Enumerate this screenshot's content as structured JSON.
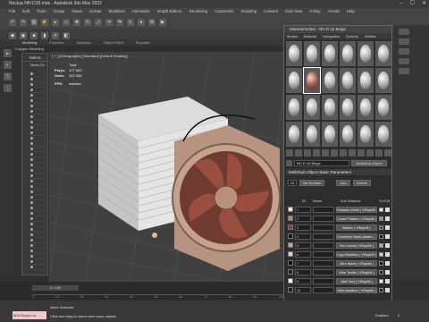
{
  "app": {
    "title": "Noctua NH-D15.max - Autodesk 3ds Max 2022",
    "win_controls": [
      "–",
      "☐",
      "✕"
    ]
  },
  "menu": [
    "File",
    "Edit",
    "Tools",
    "Group",
    "Views",
    "Create",
    "Modifiers",
    "Animation",
    "Graph Editors",
    "Rendering",
    "Customize",
    "Scripting",
    "Content",
    "Civil View",
    "V-Ray",
    "Arnold",
    "Help"
  ],
  "ribbon": {
    "tabs": [
      "Modeling",
      "Freeform",
      "Selection",
      "Object Paint",
      "Populate"
    ],
    "active": "Modeling",
    "sub": "Polygon Modeling"
  },
  "viewport": {
    "label": "[ + ] [Orthographic] [Standard] [Default Shading]",
    "stats": {
      "header": "Total",
      "polys_label": "Polys:",
      "polys": "477 663",
      "verts_label": "Verts:",
      "verts": "323 306",
      "fps_label": "FPS:",
      "fps": "Inactive"
    }
  },
  "scene_panel": {
    "title": "Select",
    "name_col": "Name (So"
  },
  "material_editor": {
    "title": "Material Editor - NH D 15 Beige",
    "menu": [
      "Modes",
      "Material",
      "Navigation",
      "Options",
      "Utilities"
    ],
    "name": "NH D 15 Beige",
    "type": "Multi/Sub-Object",
    "rollout": "Multi/Sub-Object Basic Parameters",
    "count": "25",
    "set_number": "Set Number",
    "add": "Add",
    "delete": "Delete",
    "columns": {
      "id": "ID",
      "name": "Name",
      "sub": "Sub-Material",
      "onoff": "On/Off"
    },
    "rows": [
      {
        "id": "1",
        "sub": "Radiator Metal ( VRayMtl )",
        "color": "#e6e6e6"
      },
      {
        "id": "2",
        "sub": "Cooler Pattern ( VRayMtl )",
        "color": "#b8897b"
      },
      {
        "id": "3",
        "sub": "Blades ( VRayMtl )",
        "color": "#8b3f32"
      },
      {
        "id": "4",
        "sub": "Connector black plastic ( ...",
        "color": "#151515"
      },
      {
        "id": "5",
        "sub": "Fan mount ( VRayMtl )",
        "color": "#c9a692"
      },
      {
        "id": "6",
        "sub": "Logo Radiator ( VRayMtl )",
        "color": "#d8d8d8"
      },
      {
        "id": "7",
        "sub": "Wire Black ( VRayMtl )",
        "color": "#101010"
      },
      {
        "id": "8",
        "sub": "Wire Textile ( VRayMtl )",
        "color": "#252525"
      },
      {
        "id": "9",
        "sub": "Wire Text ( VRayMtl )",
        "color": "#eeeeee"
      },
      {
        "id": "10",
        "sub": "Wire Isolation ( VRayMtl )",
        "color": "#202020"
      }
    ]
  },
  "timeline": {
    "frame": "0 / 100",
    "ticks": [
      "0",
      "10",
      "20",
      "30",
      "40",
      "50",
      "60",
      "70",
      "80",
      "90",
      "100"
    ]
  },
  "status": {
    "maxscript": "MAXScript Lis",
    "selection": "None Selected",
    "hint": "Click and drag to select and move objects",
    "enabled": "Enabled",
    "auto": "0"
  }
}
